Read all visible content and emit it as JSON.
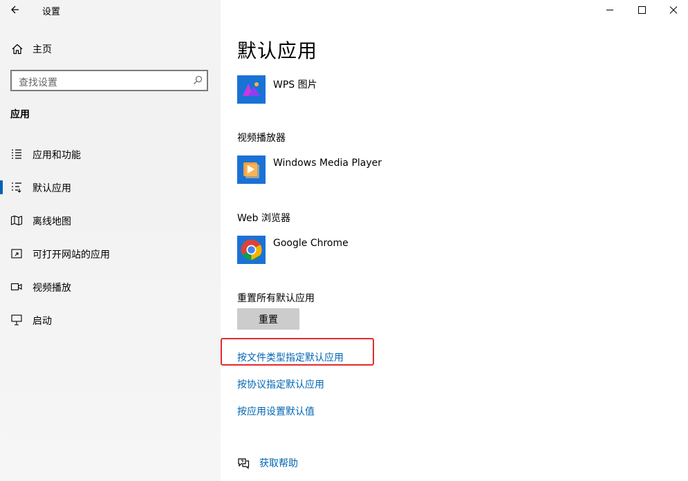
{
  "window": {
    "title": "设置",
    "back_icon": "back-arrow-icon",
    "controls": [
      "minimize-icon",
      "maximize-icon",
      "close-icon"
    ]
  },
  "sidebar": {
    "home": {
      "label": "主页",
      "icon": "home-icon"
    },
    "search": {
      "placeholder": "查找设置",
      "icon": "search-icon"
    },
    "section": "应用",
    "items": [
      {
        "label": "应用和功能",
        "icon": "list-icon",
        "active": false
      },
      {
        "label": "默认应用",
        "icon": "default-apps-icon",
        "active": true
      },
      {
        "label": "离线地图",
        "icon": "map-icon",
        "active": false
      },
      {
        "label": "可打开网站的应用",
        "icon": "open-website-icon",
        "active": false
      },
      {
        "label": "视频播放",
        "icon": "video-icon",
        "active": false
      },
      {
        "label": "启动",
        "icon": "startup-icon",
        "active": false
      }
    ]
  },
  "main": {
    "title": "默认应用",
    "photo_app": {
      "name": "WPS 图片",
      "icon": "wps-photo-icon"
    },
    "video": {
      "label": "视频播放器",
      "app": "Windows Media Player",
      "icon": "media-player-icon"
    },
    "browser": {
      "label": "Web 浏览器",
      "app": "Google Chrome",
      "icon": "chrome-icon"
    },
    "reset": {
      "label": "重置所有默认应用",
      "button": "重置"
    },
    "links": [
      "按文件类型指定默认应用",
      "按协议指定默认应用",
      "按应用设置默认值"
    ],
    "help": {
      "label": "获取帮助",
      "icon": "help-chat-icon"
    }
  },
  "colors": {
    "accent": "#0063b1",
    "link": "#0066b4",
    "highlight_box": "#e32b2b",
    "reset_button": "#cccccc"
  }
}
